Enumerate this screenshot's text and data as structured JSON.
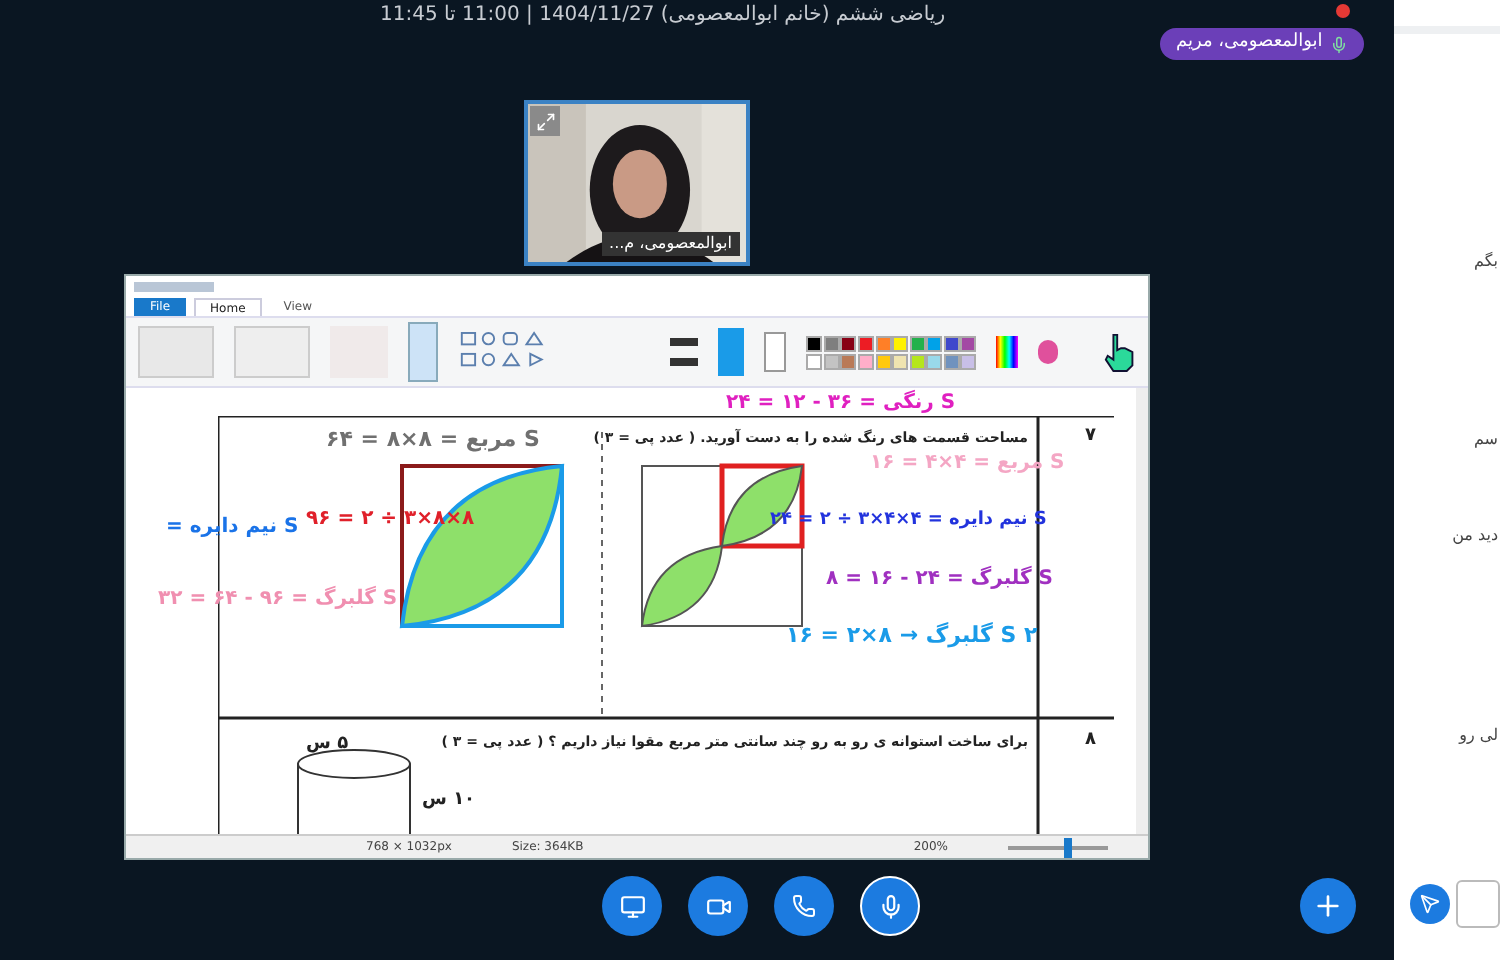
{
  "meeting": {
    "schedule": "ریاضی ششم (خانم ابوالمعصومی) 1404/11/27 | 11:00 تا 11:45",
    "presenter": "ابوالمعصومی، مریم"
  },
  "webcam": {
    "caption": "ابوالمعصومی، م..."
  },
  "paint": {
    "file_tab": "File",
    "home_tab": {
      "label": "Home",
      "selected": true
    },
    "view_tab": {
      "label": "View",
      "selected": false
    },
    "palette": [
      {
        "color": "#000000"
      },
      {
        "color": "#7f7f7f"
      },
      {
        "color": "#880015"
      },
      {
        "color": "#ed1c24"
      },
      {
        "color": "#ff7f27"
      },
      {
        "color": "#fff200"
      },
      {
        "color": "#22b14c"
      },
      {
        "color": "#00a2e8"
      },
      {
        "color": "#3f48cc"
      },
      {
        "color": "#a349a4"
      },
      {
        "color": "#ffffff"
      },
      {
        "color": "#c3c3c3"
      },
      {
        "color": "#b97a57"
      },
      {
        "color": "#ffaec9"
      },
      {
        "color": "#ffc90e"
      },
      {
        "color": "#efe4b0"
      },
      {
        "color": "#b5e61d"
      },
      {
        "color": "#99d9ea"
      },
      {
        "color": "#7092be"
      },
      {
        "color": "#c8bfe7"
      }
    ],
    "questions": [
      {
        "number": "۷",
        "text": "مساحت قسمت های رنگ شده را به دست آورید. ( عدد پی = ۳ )"
      },
      {
        "number": "۸",
        "text": "برای ساخت استوانه ی رو به رو چند سانتی متر مربع مقوا نیاز داریم ؟ ( عدد پی = ۳ )"
      }
    ],
    "handwriting": [
      {
        "text": "S مربع = ۸×۸ = ۶۴",
        "color": "#707070"
      },
      {
        "text": "۸×۸×۳ ÷ ۲ = ۹۶",
        "color": "#e0202a"
      },
      {
        "text": "S نیم دایره =",
        "color": "#1a73e8"
      },
      {
        "text": "S گلبرگ = ۹۶ - ۶۴ = ۳۲",
        "color": "#f08fb0"
      },
      {
        "text": "S رنگی = ۳۶ - ۱۲ = ۲۴",
        "color": "#e020c0"
      },
      {
        "text": "S مربع = ۴×۴ = ۱۶",
        "color": "#f4a6c4"
      },
      {
        "text": "S نیم دایره = ۴×۴×۳ ÷ ۲ = ۲۴",
        "color": "#2233dd"
      },
      {
        "text": "S گلبرگ = ۲۴ - ۱۶ = ۸",
        "color": "#a030c0"
      },
      {
        "text": "S ۲ گلبرگ → ۸×۲ = ۱۶",
        "color": "#1a9be8"
      },
      {
        "text": "۵ س",
        "color": "#222222"
      },
      {
        "text": "۱۰ س",
        "color": "#222222"
      }
    ],
    "canvas_size": "768 × 1032px",
    "file_size": "Size: 364KB",
    "zoom": "200%",
    "zoom_slider": {
      "level": 0.55
    }
  },
  "chat": {
    "messages": [
      "بگم",
      "سم",
      "دید من",
      "لی رو"
    ]
  }
}
